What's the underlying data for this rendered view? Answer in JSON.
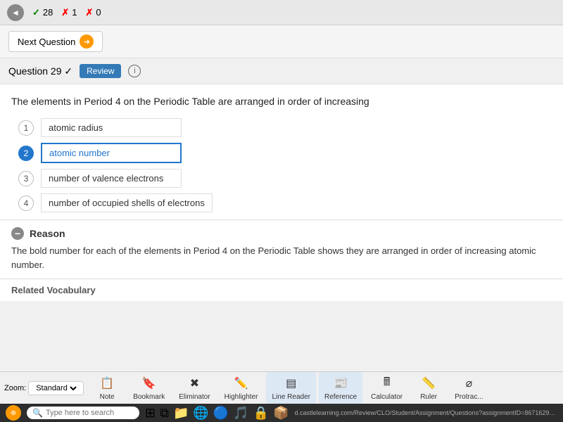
{
  "topBar": {
    "back_arrow": "◄",
    "scores": [
      {
        "icon": "✓",
        "type": "check",
        "count": "28"
      },
      {
        "icon": "✗",
        "type": "x1",
        "count": "1"
      },
      {
        "icon": "✗",
        "type": "x2",
        "count": "0"
      }
    ]
  },
  "nextQuestion": {
    "label": "Next Question",
    "arrow": "➜"
  },
  "questionHeader": {
    "label": "Question 29 ✓",
    "reviewLabel": "Review",
    "infoIcon": "i"
  },
  "question": {
    "text": "The elements in Period 4 on the Periodic Table are arranged in order of increasing",
    "choices": [
      {
        "num": "1",
        "text": "atomic radius",
        "selected": false
      },
      {
        "num": "2",
        "text": "atomic number",
        "selected": true
      },
      {
        "num": "3",
        "text": "number of valence electrons",
        "selected": false
      },
      {
        "num": "4",
        "text": "number of occupied shells of electrons",
        "selected": false
      }
    ]
  },
  "reason": {
    "title": "Reason",
    "text": "The bold number for each of the elements in Period 4 on the Periodic Table shows they are arranged in order of increasing atomic number."
  },
  "relatedVocab": {
    "title": "Related Vocabulary"
  },
  "taskbar": {
    "zoomLabel": "Zoom:",
    "zoomValue": "Standard",
    "noteLabel": "Note",
    "bookmarkLabel": "Bookmark",
    "eliminatorLabel": "Eliminator",
    "highlighterLabel": "Highlighter",
    "lineReaderLabel": "Line Reader",
    "referenceLabel": "Reference",
    "calculatorLabel": "Calculator",
    "rulerLabel": "Ruler",
    "protractorLabel": "Protrac...",
    "url": "d.castlelearning.com/Review/CLO/Student/Assignment/Questions?assignmentID=8671629&tid=6838256#",
    "searchPlaceholder": "Type here to search"
  },
  "colors": {
    "selectedBlue": "#2277cc",
    "buttonOrange": "#f90",
    "reviewBlue": "#337ab7"
  }
}
